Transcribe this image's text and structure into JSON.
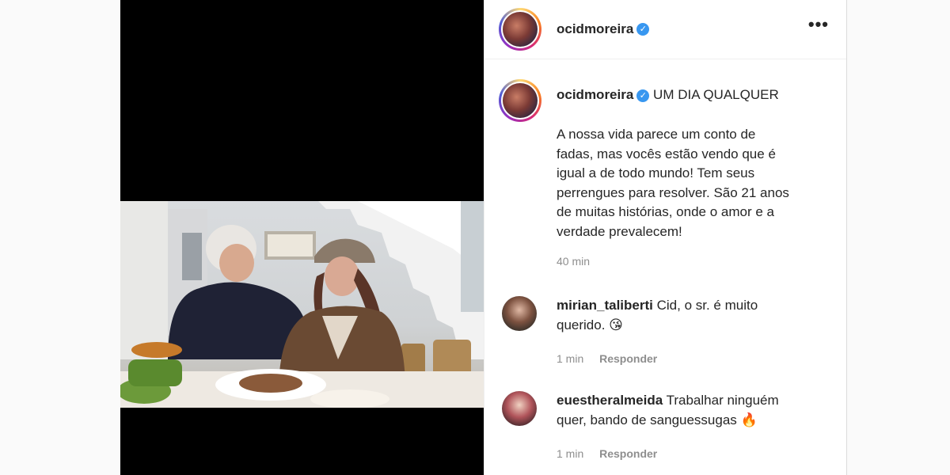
{
  "post": {
    "username": "ocidmoreira",
    "more_label": "•••",
    "caption_title": "UM DIA QUALQUER",
    "caption_lines": [
      "A nossa vida parece um conto de",
      "fadas, mas vocês estão vendo que é",
      "igual a de todo mundo! Tem seus",
      "perrengues para resolver. São 21 anos",
      "de muitas histórias, onde o amor e a",
      "verdade prevalecem!"
    ],
    "caption_time": "40 min"
  },
  "comments": [
    {
      "username": "mirian_taliberti",
      "text_line1": "Cid, o sr. é muito",
      "text_line2": "querido.",
      "emoji": "😘",
      "time": "1 min",
      "reply": "Responder"
    },
    {
      "username": "euestheralmeida",
      "text_line1": "Trabalhar ninguém",
      "text_line2": "quer, bando de sanguessugas",
      "emoji": "🔥",
      "time": "1 min",
      "reply": "Responder"
    }
  ],
  "colors": {
    "verified": "#3897f0",
    "muted": "#8e8e8e",
    "text": "#262626"
  },
  "icons": [
    "verified-badge-icon",
    "more-options-icon",
    "kiss-emoji-icon",
    "fire-emoji-icon"
  ]
}
